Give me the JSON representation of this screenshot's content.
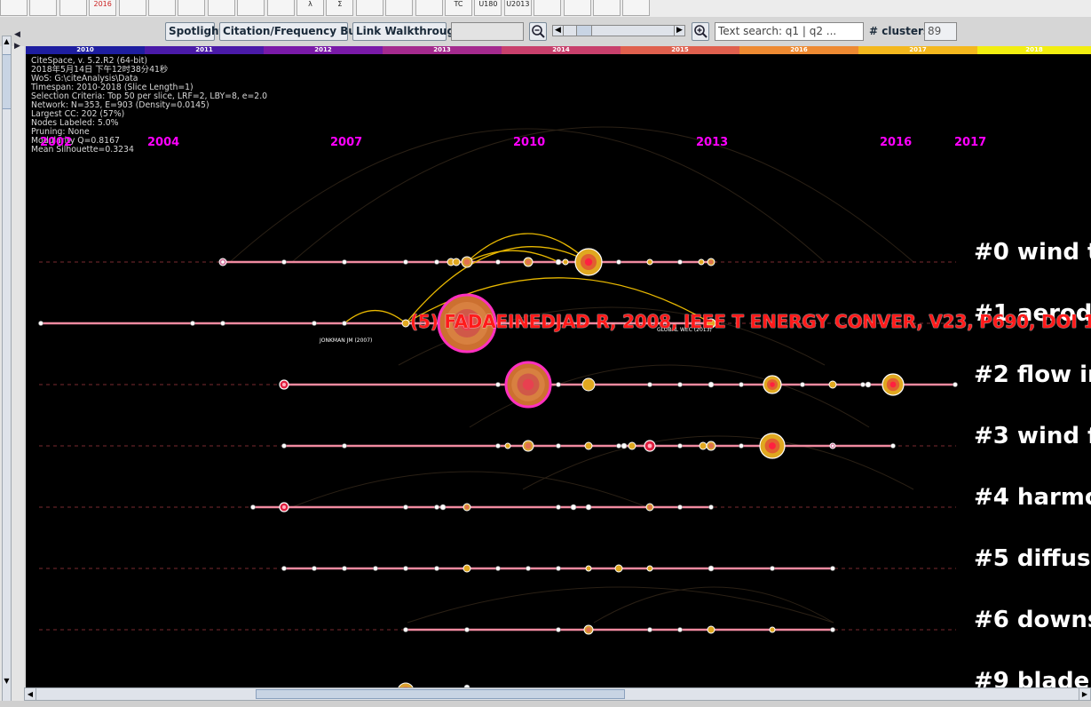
{
  "toolbar": {
    "icon_strip": [
      {
        "icon": "cluster-icon",
        "text": ""
      },
      {
        "icon": "network-icon",
        "text": ""
      },
      {
        "icon": "link-icon",
        "text": ""
      },
      {
        "icon": "calendar-icon",
        "text": "2016"
      },
      {
        "icon": "red-graph-icon",
        "text": ""
      },
      {
        "icon": "red-graph2-icon",
        "text": ""
      },
      {
        "icon": "dots-icon",
        "text": ""
      },
      {
        "icon": "bars-icon",
        "text": ""
      },
      {
        "icon": "target-icon",
        "text": ""
      },
      {
        "icon": "magnifier-icon",
        "text": ""
      },
      {
        "icon": "lambda-icon",
        "text": "λ"
      },
      {
        "icon": "sigma-icon",
        "text": "Σ"
      },
      {
        "icon": "search-node-icon",
        "text": ""
      },
      {
        "icon": "dot-icon",
        "text": ""
      },
      {
        "icon": "dot2-icon",
        "text": ""
      },
      {
        "icon": "tc-icon",
        "text": "TC"
      },
      {
        "icon": "u180-icon",
        "text": "U180"
      },
      {
        "icon": "u2013-icon",
        "text": "U2013"
      },
      {
        "icon": "arc-icon",
        "text": ""
      },
      {
        "icon": "dotted-icon",
        "text": ""
      },
      {
        "icon": "pen-icon",
        "text": ""
      },
      {
        "icon": "sun-icon",
        "text": ""
      }
    ],
    "spotlight": "Spotlight",
    "burst": "Citation/Frequency Burst",
    "walkthrough": "Link Walkthrough",
    "search_placeholder": "Text search: q1 | q2 ...",
    "clusters_label": "# clusters",
    "clusters_value": "89"
  },
  "timeline": [
    {
      "year": "2010",
      "color": "#1e1ea0"
    },
    {
      "year": "2011",
      "color": "#4a1aa8"
    },
    {
      "year": "2012",
      "color": "#7a1aa8"
    },
    {
      "year": "2013",
      "color": "#a42a8e"
    },
    {
      "year": "2014",
      "color": "#c8406c"
    },
    {
      "year": "2015",
      "color": "#e0604e"
    },
    {
      "year": "2016",
      "color": "#ee8a32"
    },
    {
      "year": "2017",
      "color": "#f4b81e"
    },
    {
      "year": "2018",
      "color": "#f2ee10"
    }
  ],
  "info": {
    "line1": "CiteSpace, v. 5.2.R2 (64-bit)",
    "line2": "2018年5月14日 下午12时38分41秒",
    "line3": "WoS: G:\\citeAnalysis\\Data",
    "line4": "Timespan: 2010-2018 (Slice Length=1)",
    "line5": "Selection Criteria: Top 50 per slice, LRF=2, LBY=8, e=2.0",
    "line6": "Network: N=353, E=903 (Density=0.0145)",
    "line7": "Largest CC: 202 (57%)",
    "line8": "Nodes Labeled: 5.0%",
    "line9": "Pruning: None",
    "line10": "Modularity Q=0.8167",
    "line11": "Mean Silhouette=0.3234"
  },
  "years": [
    "2002",
    "2004",
    "2007",
    "2010",
    "2013",
    "2016",
    "2017"
  ],
  "clusters": [
    "#0 wind t",
    "#1 aerody",
    "#2 flow ir",
    "#3 wind f",
    "#4 harmo",
    "#5 diffuse",
    "#6 downs",
    "#9 blade"
  ],
  "node_labels": {
    "jonkman": "JONKMAN JM (2007)",
    "global": "GLOBAL WEC (2013)"
  },
  "highlight_label": "(5) FADAEINEDJAD R, 2008, IEEE T ENERGY CONVER, V23, P690, DOI 10.1109"
}
